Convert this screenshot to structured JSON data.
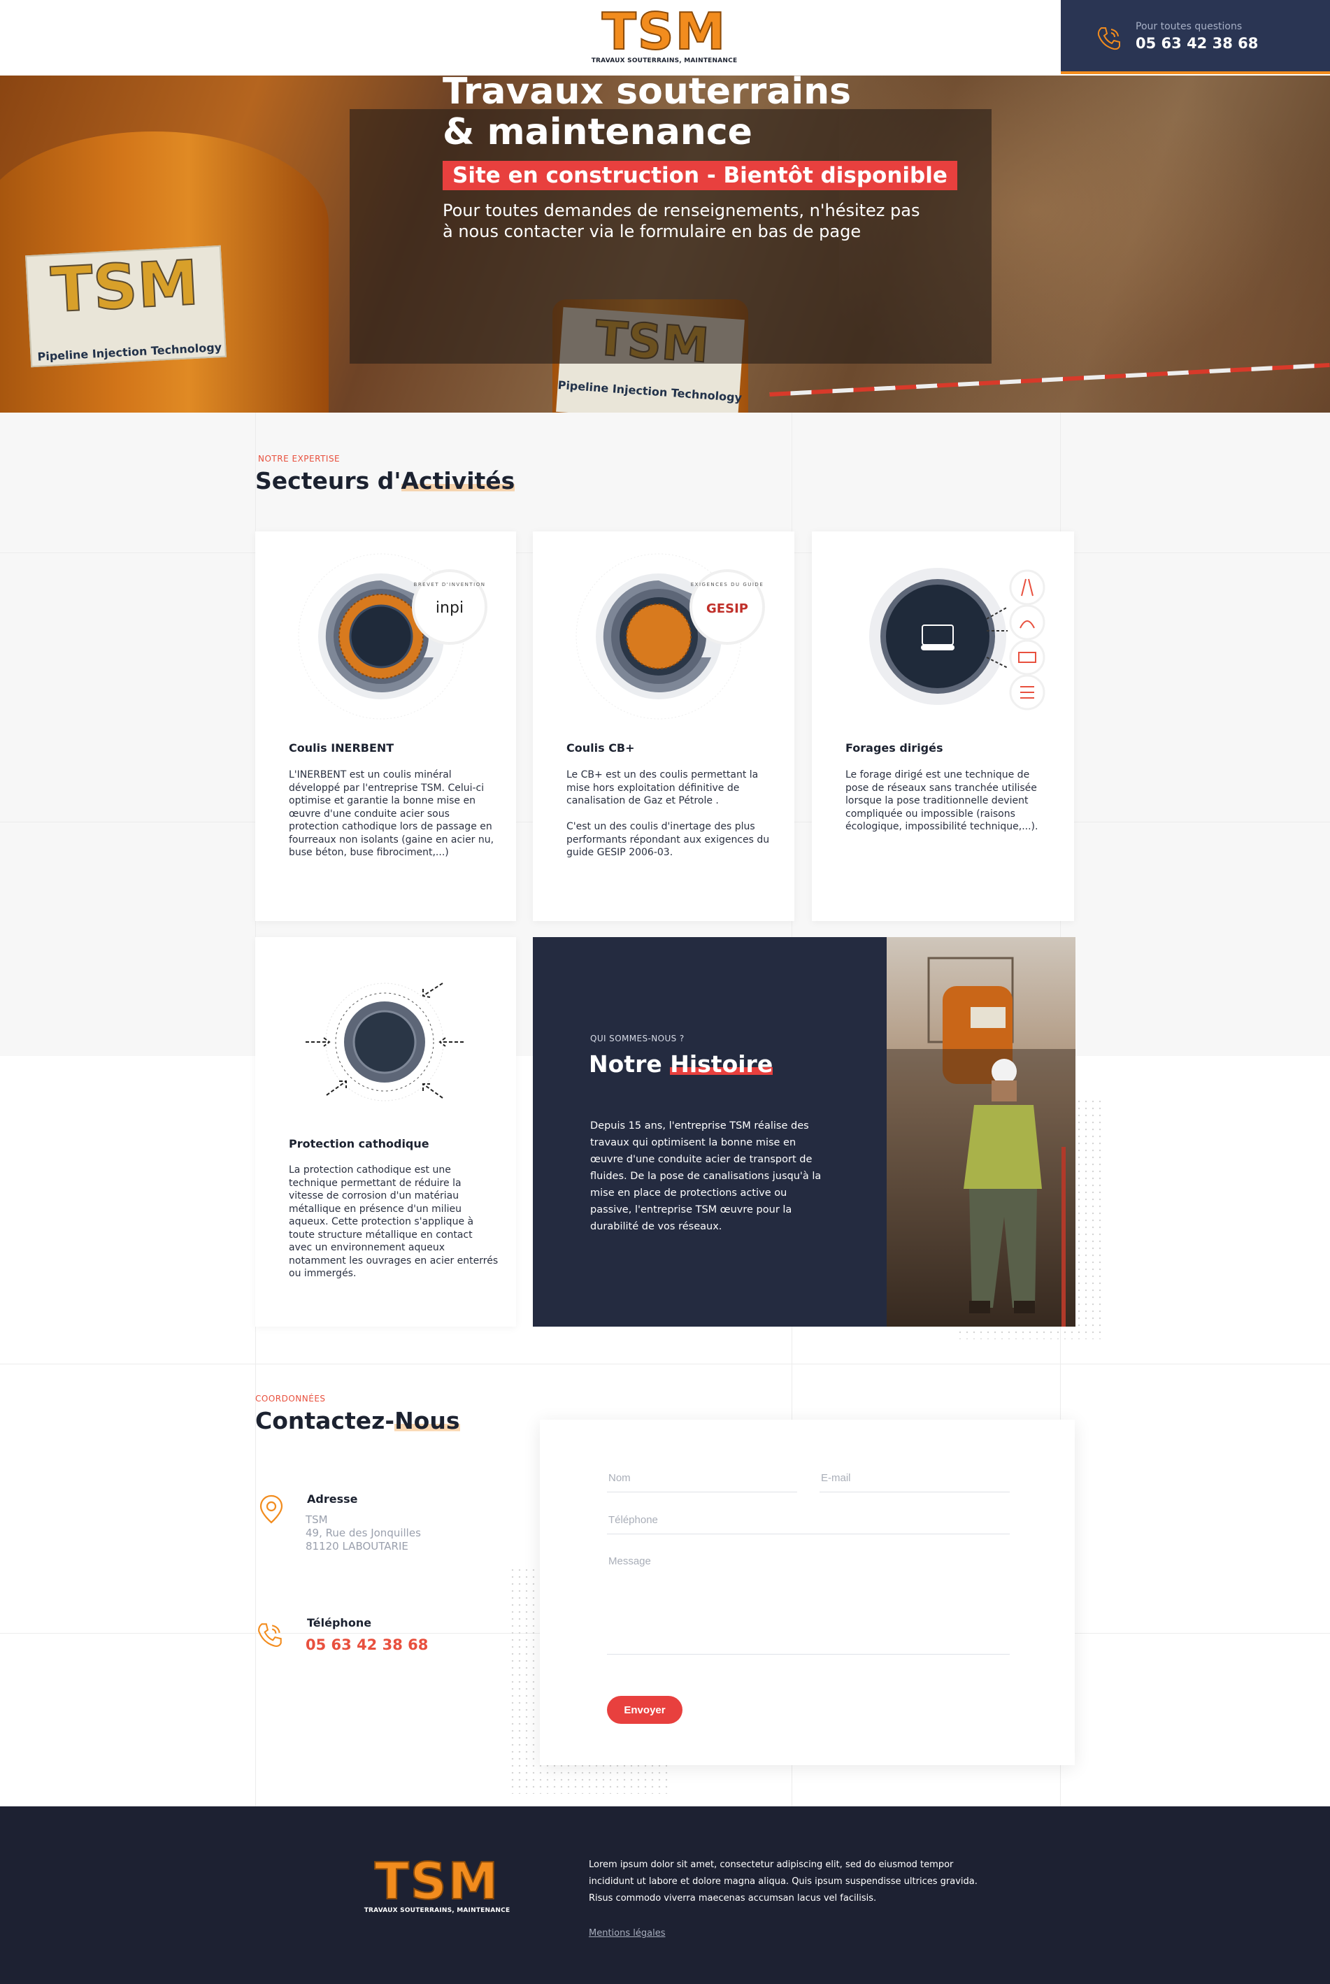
{
  "header": {
    "logo_text": "TSM",
    "logo_subtitle": "TRAVAUX SOUTERRAINS, MAINTENANCE",
    "phone_label": "Pour toutes questions",
    "phone_number": "05 63 42 38 68"
  },
  "hero": {
    "tank_logo": "TSM",
    "tank_sub1": "Travaux Souterrains & Maintenance",
    "tank_sub2": "Pipeline Injection Technology",
    "title_line1": "Travaux souterrains",
    "title_line2": "& maintenance",
    "badge": "Site en construction - Bientôt disponible",
    "text": "Pour toutes demandes de renseignements, n'hésitez pas à nous contacter via le formulaire en bas de page"
  },
  "activities": {
    "eyebrow": "NOTRE EXPERTISE",
    "title_part1": "Secteurs d'",
    "title_part2": "Activités",
    "cards": [
      {
        "title": "Coulis INERBENT",
        "text": "L'INERBENT est un coulis minéral développé par l'entreprise TSM. Celui-ci optimise et garantie la bonne mise en œuvre d'une conduite acier sous protection cathodique lors de passage en fourreaux non isolants (gaine en acier nu, buse béton, buse fibrociment,...)",
        "badge": "inpi",
        "badge_ring": "BREVET D'INVENTION"
      },
      {
        "title": "Coulis CB+",
        "text": "Le CB+ est un des coulis permettant la mise hors exploitation définitive de canalisation de Gaz et Pétrole .\n\nC'est un des coulis d'inertage des plus performants répondant aux exigences du guide GESIP 2006-03.",
        "badge": "GESIP",
        "badge_ring": "EXIGENCES DU GUIDE"
      },
      {
        "title": "Forages dirigés",
        "text": "Le forage dirigé est une technique de pose de réseaux sans tranchée utilisée lorsque la pose traditionnelle devient compliquée ou impossible (raisons écologique, impossibilité technique,...)."
      },
      {
        "title": "Protection cathodique",
        "text": "La protection cathodique est une technique permettant de réduire la vitesse de corrosion d'un matériau métallique en présence d'un milieu aqueux. Cette protection s'applique à toute structure métallique en contact avec un environnement aqueux notamment les ouvrages en acier enterrés ou immergés."
      }
    ]
  },
  "history": {
    "eyebrow": "QUI SOMMES-NOUS ?",
    "title_part1": "Notre ",
    "title_part2": "Histoire",
    "text": "Depuis 15 ans, l'entreprise TSM réalise des travaux qui optimisent la bonne mise en œuvre d'une conduite acier de transport de fluides. De la pose de canalisations jusqu'à la mise en place de protections active ou passive, l'entreprise TSM œuvre pour la durabilité de vos réseaux."
  },
  "contact": {
    "eyebrow": "COORDONNÉES",
    "title_part1": "Contactez-",
    "title_part2": "Nous",
    "address_title": "Adresse",
    "address_text": "TSM\n49, Rue des Jonquilles\n81120 LABOUTARIE",
    "phone_title": "Téléphone",
    "phone_number": "05 63 42 38 68",
    "form": {
      "name_placeholder": "Nom",
      "email_placeholder": "E-mail",
      "phone_placeholder": "Téléphone",
      "message_placeholder": "Message",
      "submit_label": "Envoyer"
    }
  },
  "footer": {
    "logo_text": "TSM",
    "logo_subtitle": "TRAVAUX SOUTERRAINS, MAINTENANCE",
    "text": "Lorem ipsum dolor sit amet, consectetur adipiscing elit, sed do eiusmod tempor incididunt ut labore et dolore magna aliqua. Quis ipsum suspendisse ultrices gravida. Risus commodo viverra maecenas accumsan lacus vel facilisis.",
    "legal_link": "Mentions légales"
  },
  "colors": {
    "accent_red": "#e8403e",
    "brand_orange": "#f28c1e",
    "navy": "#242b40",
    "footer_bg": "#1d2132"
  }
}
